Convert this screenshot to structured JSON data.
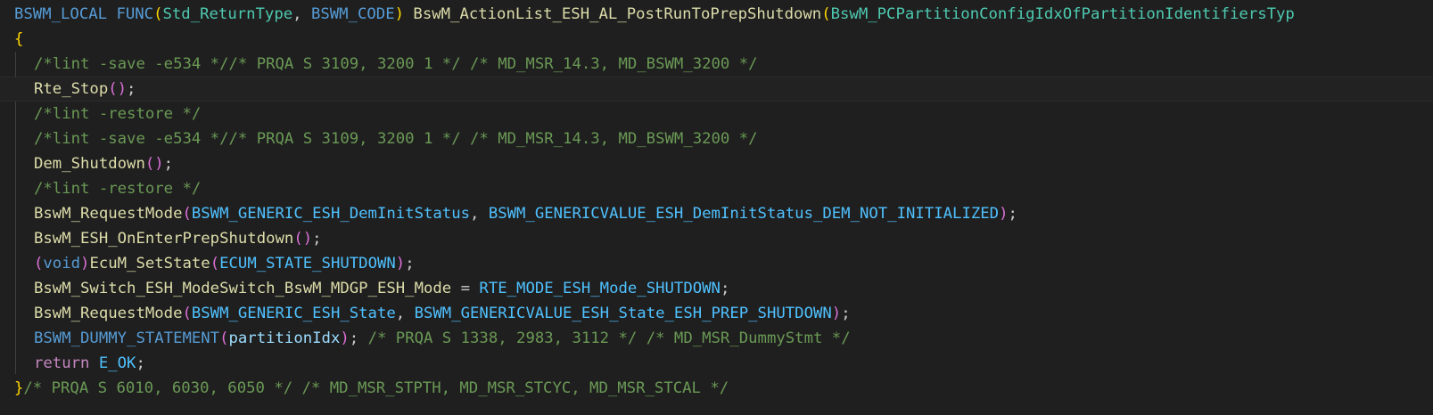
{
  "colors": {
    "background": "#1f1f1f",
    "keyword": "#569cd6",
    "control": "#c586c0",
    "type": "#4ec9b0",
    "function": "#dcdcaa",
    "macro": "#4fc1ff",
    "comment": "#6a9955",
    "variable": "#9cdcfe",
    "bracket_level1": "#ffd700",
    "bracket_level2": "#da70d6",
    "plain": "#cccccc"
  },
  "code": {
    "header": {
      "local_macro": "BSWM_LOCAL",
      "func_macro": "FUNC",
      "open_paren": "(",
      "return_type": "Std_ReturnType",
      "comma": ", ",
      "code_class": "BSWM_CODE",
      "close_paren": ")",
      "space": " ",
      "function_name": "BswM_ActionList_ESH_AL_PostRunToPrepShutdown",
      "param_open": "(",
      "param_type": "BswM_PCPartitionConfigIdxOfPartitionIdentifiersTyp"
    },
    "open_brace": "{",
    "lint_save_1": "/*lint -save -e534 *//* PRQA S 3109, 3200 1 */ /* MD_MSR_14.3, MD_BSWM_3200 */",
    "rte_stop": {
      "name": "Rte_Stop",
      "parens": "()",
      "semi": ";"
    },
    "lint_restore_1": "/*lint -restore */",
    "lint_save_2": "/*lint -save -e534 *//* PRQA S 3109, 3200 1 */ /* MD_MSR_14.3, MD_BSWM_3200 */",
    "dem_shutdown": {
      "name": "Dem_Shutdown",
      "parens": "()",
      "semi": ";"
    },
    "lint_restore_2": "/*lint -restore */",
    "request_mode_1": {
      "name": "BswM_RequestMode",
      "open": "(",
      "arg1": "BSWM_GENERIC_ESH_DemInitStatus",
      "comma": ", ",
      "arg2": "BSWM_GENERICVALUE_ESH_DemInitStatus_DEM_NOT_INITIALIZED",
      "close": ")",
      "semi": ";"
    },
    "on_enter_prep": {
      "name": "BswM_ESH_OnEnterPrepShutdown",
      "parens": "()",
      "semi": ";"
    },
    "set_state": {
      "cast_open": "(",
      "cast_type": "void",
      "cast_close": ")",
      "name": "EcuM_SetState",
      "open": "(",
      "arg": "ECUM_STATE_SHUTDOWN",
      "close": ")",
      "semi": ";"
    },
    "mode_switch": {
      "lhs": "BswM_Switch_ESH_ModeSwitch_BswM_MDGP_ESH_Mode",
      "op": " = ",
      "rhs": "RTE_MODE_ESH_Mode_SHUTDOWN",
      "semi": ";"
    },
    "request_mode_2": {
      "name": "BswM_RequestMode",
      "open": "(",
      "arg1": "BSWM_GENERIC_ESH_State",
      "comma": ", ",
      "arg2": "BSWM_GENERICVALUE_ESH_State_ESH_PREP_SHUTDOWN",
      "close": ")",
      "semi": ";"
    },
    "dummy_statement": {
      "name": "BSWM_DUMMY_STATEMENT",
      "open": "(",
      "arg": "partitionIdx",
      "close": ")",
      "semi": "; ",
      "comment": "/* PRQA S 1338, 2983, 3112 */ /* MD_MSR_DummyStmt */"
    },
    "return_stmt": {
      "keyword": "return",
      "space": " ",
      "value": "E_OK",
      "semi": ";"
    },
    "close_brace": "}",
    "close_comment": "/* PRQA S 6010, 6030, 6050 */ /* MD_MSR_STPTH, MD_MSR_STCYC, MD_MSR_STCAL */"
  }
}
